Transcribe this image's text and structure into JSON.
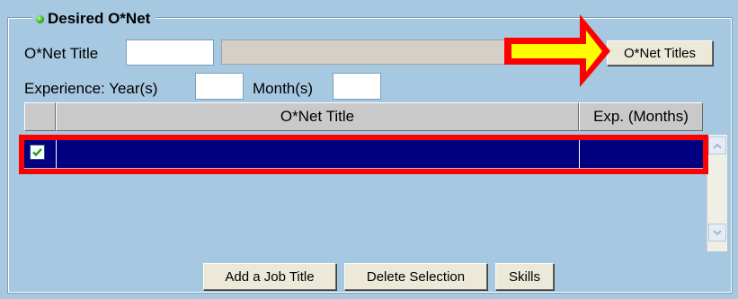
{
  "panel": {
    "title": "Desired O*Net"
  },
  "fields": {
    "onet_title_label": "O*Net Title",
    "onet_title_value": "",
    "onet_title_desc_value": "",
    "experience_label": "Experience: Year(s)",
    "years_value": "",
    "months_label": "Month(s)",
    "months_value": ""
  },
  "buttons": {
    "onet_titles": "O*Net Titles",
    "add_job_title": "Add a Job Title",
    "delete_selection": "Delete Selection",
    "skills": "Skills"
  },
  "grid": {
    "columns": [
      "",
      "O*Net Title",
      "Exp. (Months)"
    ],
    "rows": [
      {
        "checked": true,
        "title": "",
        "exp_months": ""
      }
    ]
  },
  "colors": {
    "background": "#a6c8e0",
    "selected_row": "#000080",
    "highlight": "#ff0000",
    "arrow_fill": "#ffff00"
  }
}
